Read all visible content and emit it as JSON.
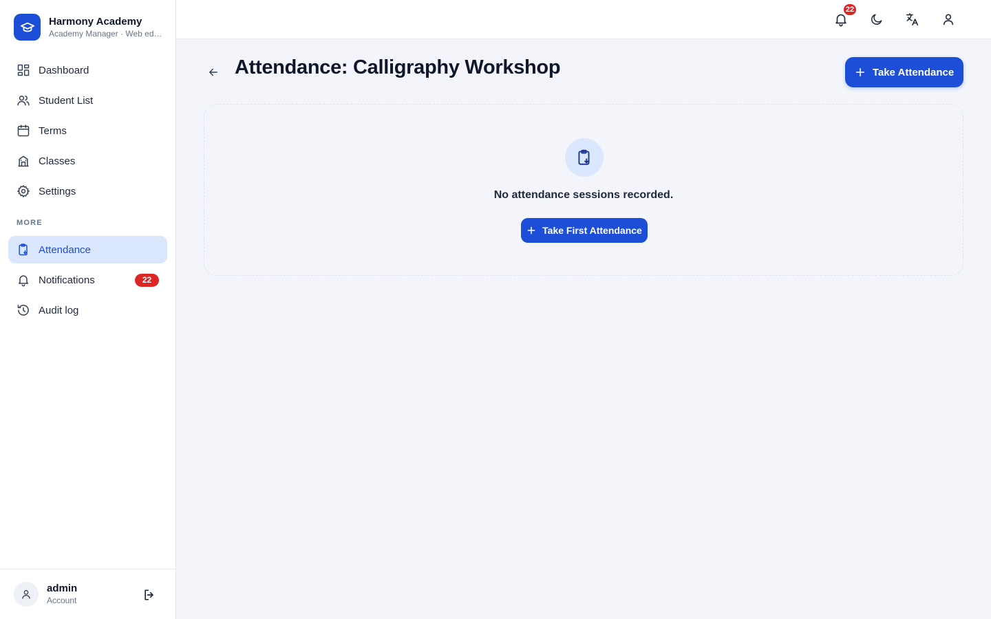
{
  "brand": {
    "title": "Harmony Academy",
    "subtitle": "Academy Manager · Web edition"
  },
  "nav": {
    "primary": [
      {
        "label": "Dashboard",
        "icon": "dashboard-icon"
      },
      {
        "label": "Student List",
        "icon": "users-icon"
      },
      {
        "label": "Terms",
        "icon": "calendar-icon"
      },
      {
        "label": "Classes",
        "icon": "building-icon"
      },
      {
        "label": "Settings",
        "icon": "gear-icon"
      }
    ],
    "section_label": "MORE",
    "more": [
      {
        "label": "Attendance",
        "icon": "clipboard-check-icon",
        "active": true
      },
      {
        "label": "Notifications",
        "icon": "bell-icon",
        "badge": "22"
      },
      {
        "label": "Audit log",
        "icon": "history-icon"
      }
    ]
  },
  "account": {
    "name": "admin",
    "role": "Account"
  },
  "topbar": {
    "notification_count": "22"
  },
  "page": {
    "title": "Attendance: Calligraphy Workshop",
    "primary_action": "Take Attendance",
    "empty_message": "No attendance sessions recorded.",
    "empty_action": "Take First Attendance"
  },
  "colors": {
    "accent": "#1d4ed8",
    "accent_soft": "#dbe7fd",
    "badge": "#dc2626"
  }
}
